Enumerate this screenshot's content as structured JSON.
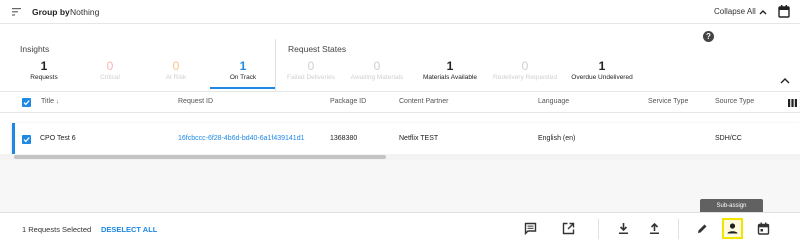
{
  "header": {
    "group_by_label": "Group by",
    "group_by_value": "Nothing",
    "collapse_label": "Collapse All"
  },
  "insights": {
    "title": "Insights",
    "metrics": [
      {
        "value": "1",
        "label": "Requests"
      },
      {
        "value": "0",
        "label": "Critical"
      },
      {
        "value": "0",
        "label": "At Risk"
      },
      {
        "value": "1",
        "label": "On Track"
      }
    ]
  },
  "request_states": {
    "title": "Request States",
    "metrics": [
      {
        "value": "0",
        "label": "Failed Deliveries"
      },
      {
        "value": "0",
        "label": "Awaiting Materials"
      },
      {
        "value": "1",
        "label": "Materials Available"
      },
      {
        "value": "0",
        "label": "Redelivery Requested"
      },
      {
        "value": "1",
        "label": "Overdue Undelivered"
      }
    ]
  },
  "table": {
    "columns": [
      "Title",
      "Request ID",
      "Package ID",
      "Content Partner",
      "Language",
      "Service Type",
      "Source Type"
    ],
    "sort_indicator": "↓",
    "rows": [
      {
        "title": "CPO Test 6",
        "request_id": "16fcbccc-6f28-4b6d-bd40-6a1f439141d1",
        "package_id": "1368380",
        "content_partner": "Netflix TEST",
        "language": "English (en)",
        "service_type": "",
        "source_type": "SDH/CC"
      }
    ]
  },
  "footer": {
    "selection_text": "1 Requests Selected",
    "deselect_label": "DESELECT ALL",
    "tooltip": "Sub-assign"
  },
  "colors": {
    "accent": "#1e88e5",
    "highlight": "#f2e600"
  }
}
